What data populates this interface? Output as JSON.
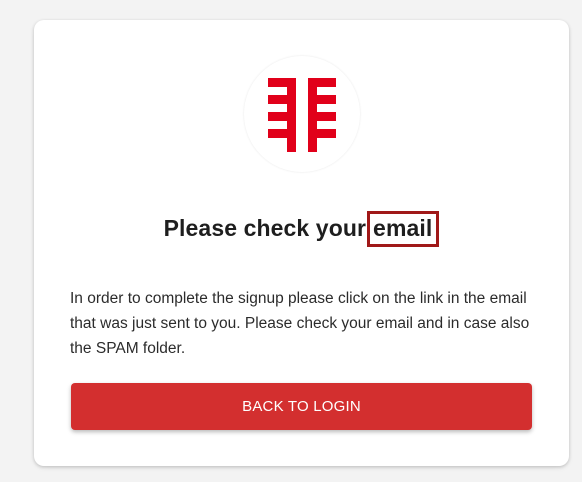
{
  "card": {
    "title_prefix": "Please check your",
    "title_highlight": "email",
    "message": "In order to complete the signup please click on the link in the email that was just sent to you. Please check your email and in case also the SPAM folder.",
    "button_label": "BACK TO LOGIN"
  },
  "logo": {
    "icon": "brand-logo-icon",
    "color": "#e1001a"
  },
  "colors": {
    "button": "#d32f2f",
    "highlight_border": "#a01818"
  }
}
